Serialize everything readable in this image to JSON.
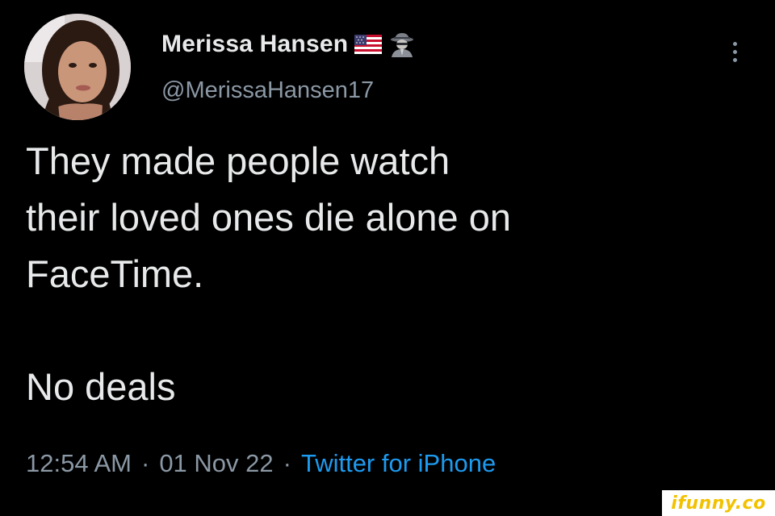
{
  "tweet": {
    "display_name": "Merissa Hansen",
    "handle": "@MerissaHansen17",
    "badges": [
      "us-flag-icon",
      "spy-icon"
    ],
    "lines": [
      "They made people watch",
      "their loved ones die alone on",
      "FaceTime."
    ],
    "last_line": "No deals",
    "time": "12:54 AM",
    "date": "01 Nov 22",
    "separator": "·",
    "source": "Twitter for iPhone"
  },
  "watermark": "ifunny.co",
  "colors": {
    "background": "#000000",
    "text": "#e7e9ea",
    "muted": "#8b98a5",
    "link": "#1d9bf0",
    "watermark": "#f2c200"
  },
  "icons": {
    "more": "more-vertical-icon",
    "avatar": "profile-photo"
  }
}
